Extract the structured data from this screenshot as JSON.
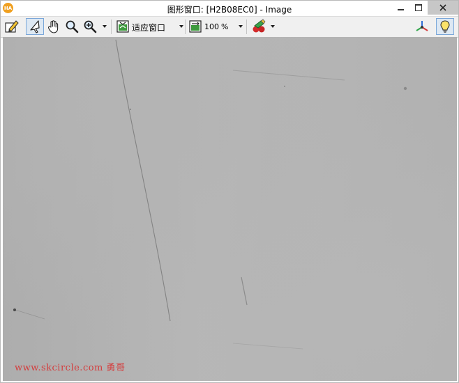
{
  "window": {
    "title": "图形窗口: [H2B08EC0] - Image",
    "logo_text": "HA"
  },
  "toolbar": {
    "fit_mode": "适应窗口",
    "zoom_value": "100",
    "zoom_unit": "%"
  },
  "canvas": {
    "watermark": "www.skcircle.com 勇哥"
  },
  "colors": {
    "accent": "#7aa7d9",
    "logo": "#f0a020",
    "watermark": "#d43c3c",
    "close_button_bg": "#c7c7c7"
  }
}
